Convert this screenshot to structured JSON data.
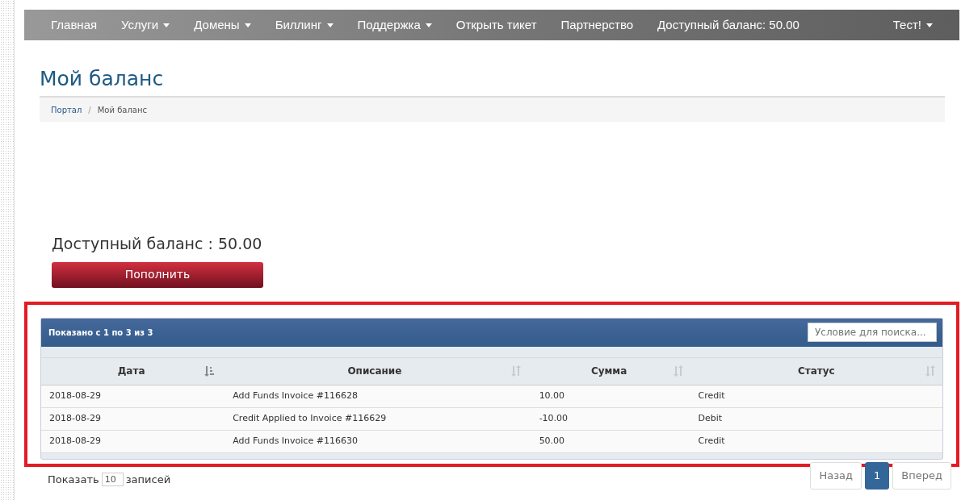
{
  "navbar": {
    "items": [
      {
        "label": "Главная",
        "dropdown": false
      },
      {
        "label": "Услуги",
        "dropdown": true
      },
      {
        "label": "Домены",
        "dropdown": true
      },
      {
        "label": "Биллинг",
        "dropdown": true
      },
      {
        "label": "Поддержка",
        "dropdown": true
      },
      {
        "label": "Открыть тикет",
        "dropdown": false
      },
      {
        "label": "Партнерство",
        "dropdown": false
      },
      {
        "label": "Доступный баланс: 50.00",
        "dropdown": false
      }
    ],
    "user": {
      "label": "Тест!",
      "dropdown": true
    }
  },
  "page_title": "Мой баланс",
  "breadcrumb": [
    {
      "label": "Портал",
      "link": true
    },
    {
      "label": "Мой баланс",
      "link": false
    }
  ],
  "breadcrumb_separator": "/",
  "balance": {
    "text": "Доступный баланс : 50.00",
    "button": "Пополнить"
  },
  "table": {
    "info": "Показано с 1 по 3 из 3",
    "search": {
      "placeholder": "Условие для поиска..."
    },
    "columns": [
      {
        "label": "Дата",
        "sorted": true
      },
      {
        "label": "Описание",
        "sorted": false
      },
      {
        "label": "Сумма",
        "sorted": false
      },
      {
        "label": "Статус",
        "sorted": false
      }
    ],
    "rows": [
      [
        "2018-08-29",
        "Add Funds Invoice #116628",
        "10.00",
        "Credit"
      ],
      [
        "2018-08-29",
        "Credit Applied to Invoice #116629",
        "-10.00",
        "Debit"
      ],
      [
        "2018-08-29",
        "Add Funds Invoice #116630",
        "50.00",
        "Credit"
      ]
    ]
  },
  "length": {
    "before": "Показать",
    "value": "10",
    "after": "записей"
  },
  "pagination": {
    "prev": "Назад",
    "pages": [
      {
        "label": "1",
        "selected": true
      }
    ],
    "next": "Вперед"
  }
}
